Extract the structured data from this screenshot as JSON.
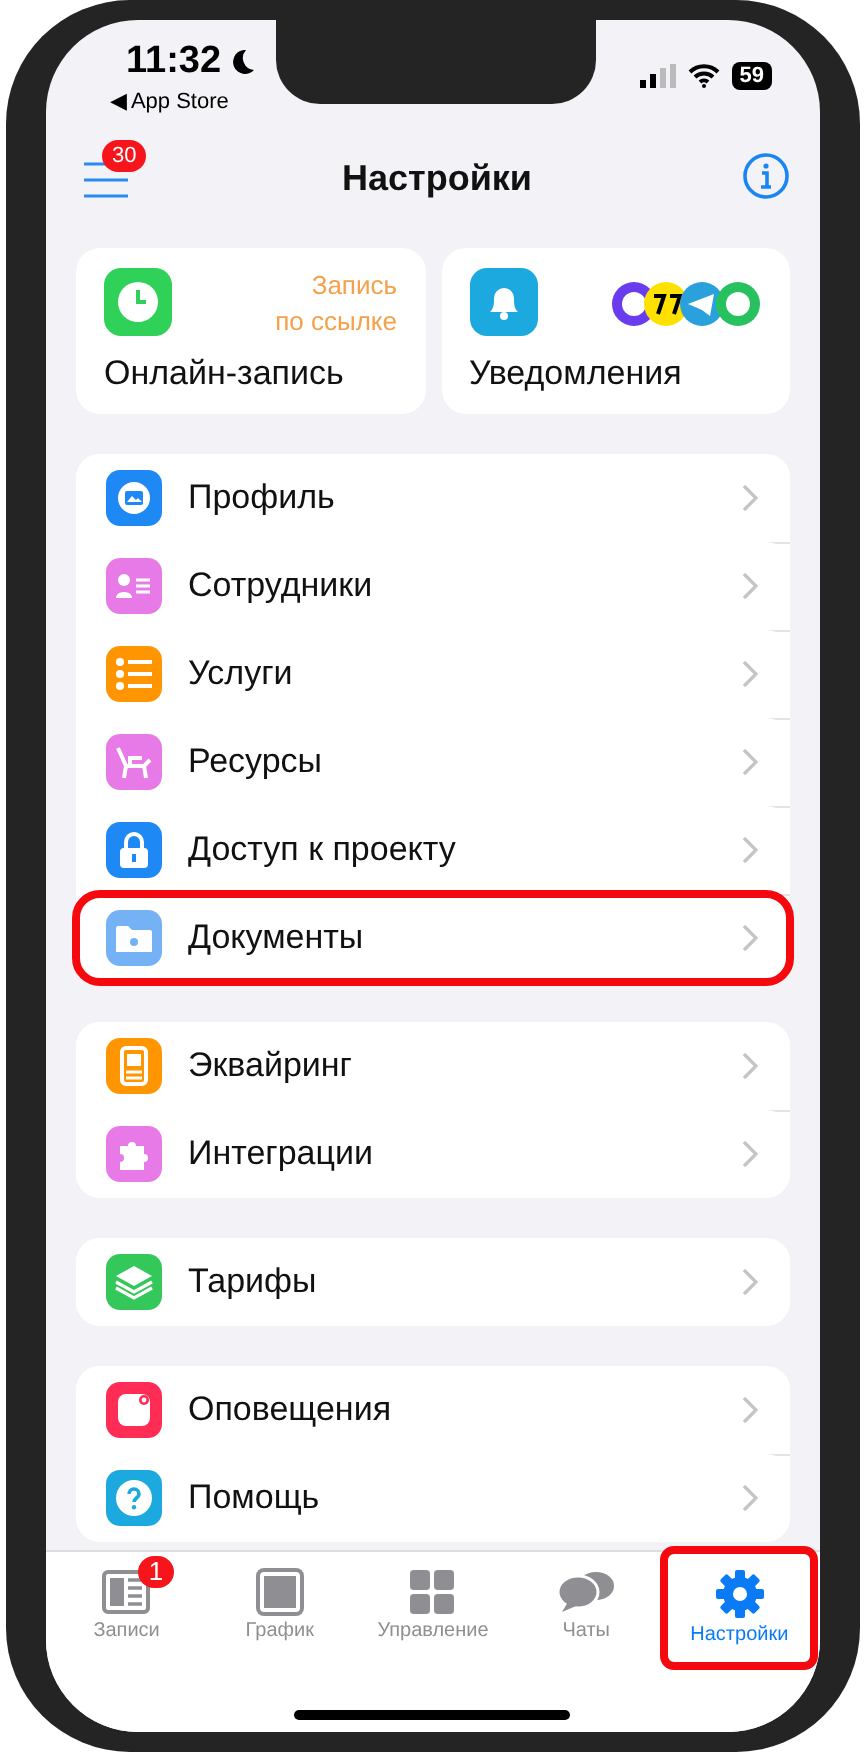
{
  "status_bar": {
    "time": "11:32",
    "back_link": "◀ App Store",
    "battery": "59"
  },
  "header": {
    "title": "Настройки",
    "menu_badge": "30"
  },
  "cards": [
    {
      "kind": "clock",
      "color": "#30d158",
      "label": "Онлайн-запись",
      "note": "Запись\nпо ссылке"
    },
    {
      "kind": "bell",
      "color": "#1ba9df",
      "label": "Уведомления"
    }
  ],
  "groups": [
    [
      {
        "kind": "profile",
        "color": "#1e88f5",
        "label": "Профиль",
        "highlighted": false
      },
      {
        "kind": "staff",
        "color": "#e87ae8",
        "label": "Сотрудники",
        "highlighted": false
      },
      {
        "kind": "list",
        "color": "#ff9500",
        "label": "Услуги",
        "highlighted": false
      },
      {
        "kind": "chair",
        "color": "#e87ae8",
        "label": "Ресурсы",
        "highlighted": false
      },
      {
        "kind": "lock",
        "color": "#1e88f5",
        "label": "Доступ к проекту",
        "highlighted": false
      },
      {
        "kind": "folder",
        "color": "#74b1f5",
        "label": "Документы",
        "highlighted": true
      }
    ],
    [
      {
        "kind": "terminal",
        "color": "#ff9500",
        "label": "Эквайринг",
        "highlighted": false
      },
      {
        "kind": "puzzle",
        "color": "#e87ae8",
        "label": "Интеграции",
        "highlighted": false
      }
    ],
    [
      {
        "kind": "layers",
        "color": "#34c759",
        "label": "Тарифы",
        "highlighted": false
      }
    ],
    [
      {
        "kind": "notice",
        "color": "#ff2d55",
        "label": "Оповещения",
        "highlighted": false
      },
      {
        "kind": "help",
        "color": "#1ba9df",
        "label": "Помощь",
        "highlighted": false
      }
    ]
  ],
  "tabs": [
    {
      "kind": "records",
      "label": "Записи",
      "badge": "1",
      "selected": false,
      "highlighted": false
    },
    {
      "kind": "calendar",
      "label": "График",
      "selected": false,
      "highlighted": false
    },
    {
      "kind": "grid",
      "label": "Управление",
      "selected": false,
      "highlighted": false
    },
    {
      "kind": "chats",
      "label": "Чаты",
      "selected": false,
      "highlighted": false
    },
    {
      "kind": "gear",
      "label": "Настройки",
      "selected": true,
      "highlighted": true
    }
  ]
}
